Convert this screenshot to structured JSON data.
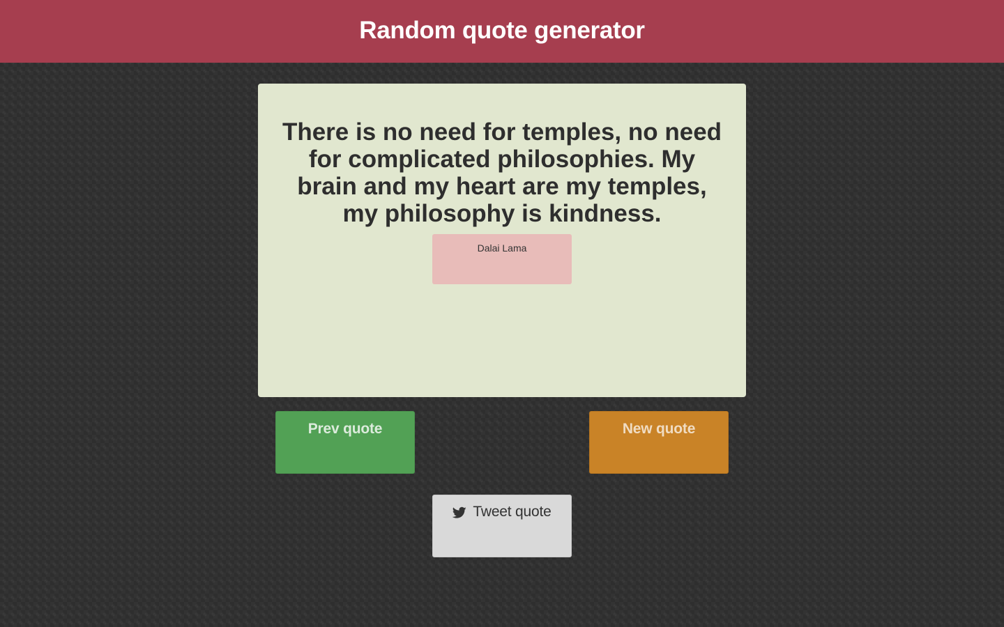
{
  "header": {
    "title": "Random quote generator"
  },
  "quote": {
    "text": "There is no need for temples, no need for complicated philosophies. My brain and my heart are my temples, my philosophy is kindness.",
    "author": "Dalai Lama"
  },
  "buttons": {
    "prev_label": "Prev quote",
    "new_label": "New quote",
    "tweet_label": "Tweet quote",
    "tweet_icon": "twitter-icon"
  },
  "colors": {
    "header_bg": "#a63e4f",
    "card_bg": "#e1e7cf",
    "author_bg": "#e8bcb9",
    "prev_bg": "#52a155",
    "new_bg": "#c98327",
    "tweet_bg": "#d9d9d9",
    "page_bg": "#333333"
  }
}
